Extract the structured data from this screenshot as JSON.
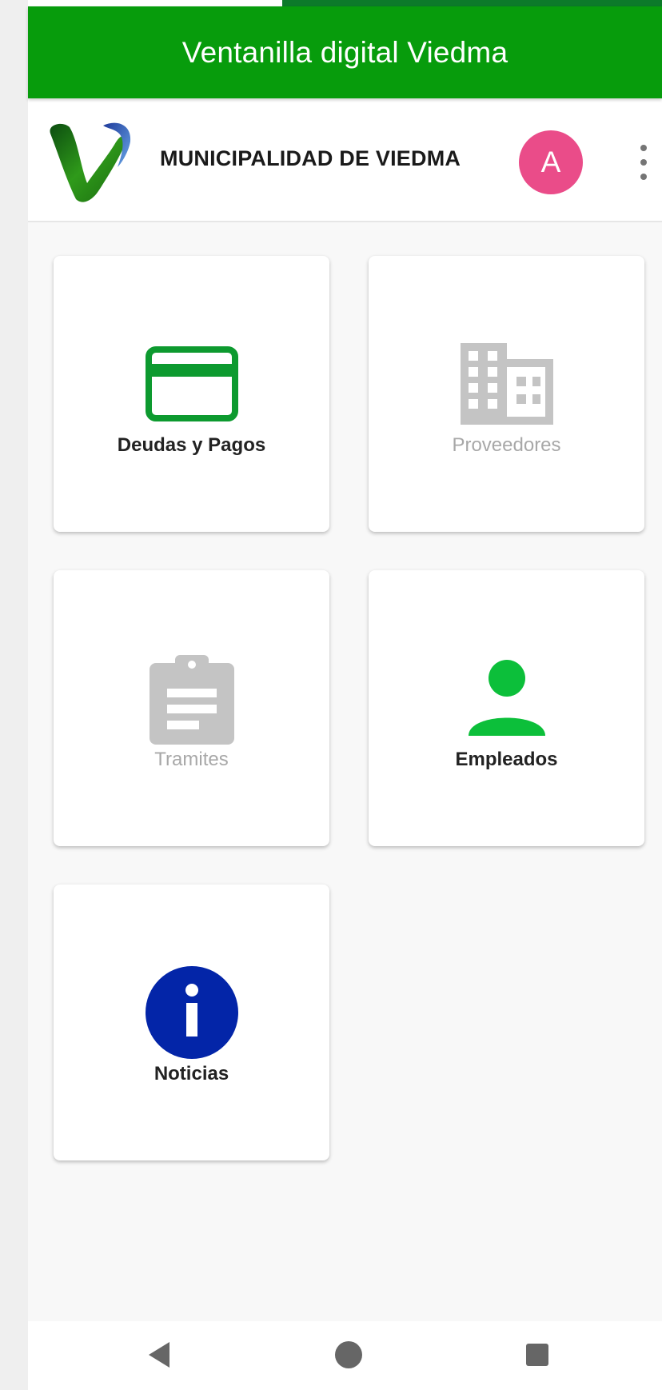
{
  "app_bar": {
    "title": "Ventanilla digital Viedma",
    "color": "#079c0c"
  },
  "header": {
    "municipality": "MUNICIPALIDAD DE VIEDMA",
    "logo_icon": "viedma-logo-icon",
    "avatar_initial": "A",
    "avatar_color": "#ea4c89",
    "menu_icon": "more-vert-icon"
  },
  "menu": {
    "items": [
      {
        "label": "Deudas y Pagos",
        "icon": "credit-card-icon",
        "enabled": true,
        "icon_color": "#0d9a2f"
      },
      {
        "label": "Proveedores",
        "icon": "business-icon",
        "enabled": false,
        "icon_color": "#c4c4c4"
      },
      {
        "label": "Tramites",
        "icon": "assignment-icon",
        "enabled": false,
        "icon_color": "#c4c4c4"
      },
      {
        "label": "Empleados",
        "icon": "person-icon",
        "enabled": true,
        "icon_color": "#0cbf3a"
      },
      {
        "label": "Noticias",
        "icon": "info-icon",
        "enabled": true,
        "icon_color": "#0325a8"
      }
    ]
  },
  "nav_bar": {
    "back_icon": "back-triangle-icon",
    "home_icon": "home-circle-icon",
    "recents_icon": "recents-square-icon"
  }
}
